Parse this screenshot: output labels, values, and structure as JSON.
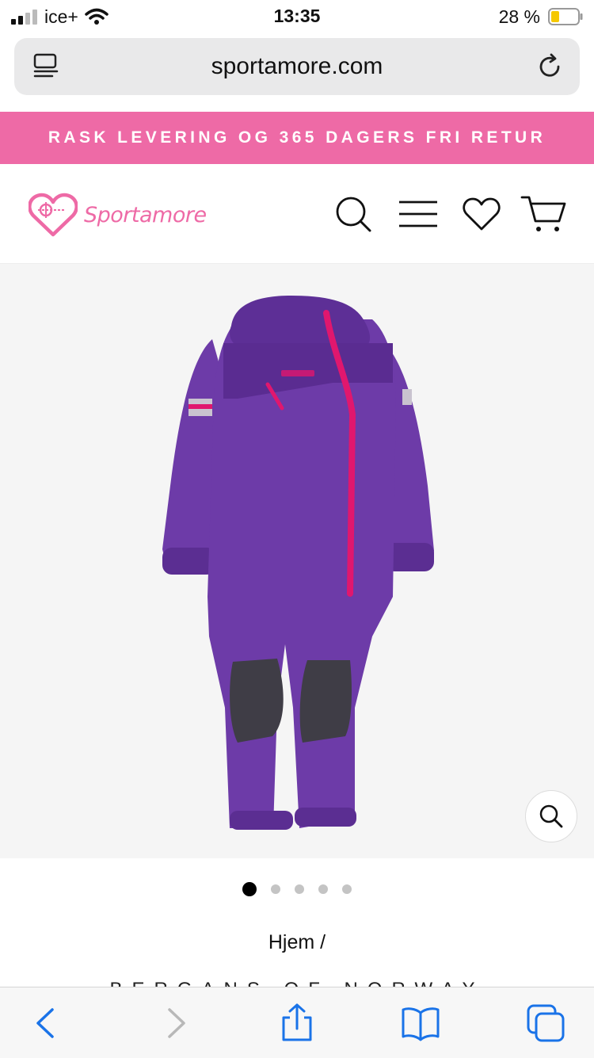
{
  "status_bar": {
    "carrier": "ice+",
    "time": "13:35",
    "battery": "28 %"
  },
  "browser": {
    "url": "sportamore.com"
  },
  "promo": {
    "text": "RASK LEVERING OG 365 DAGERS FRI RETUR"
  },
  "header": {
    "logo_text": "Sportamore"
  },
  "colors": {
    "brand_pink": "#ee6aa6",
    "product_purple": "#6a3aa3",
    "zipper_pink": "#e0176e"
  },
  "icons": [
    "reader-icon",
    "reload-icon",
    "search-icon",
    "menu-icon",
    "heart-icon",
    "cart-icon",
    "zoom-icon",
    "back-icon",
    "forward-icon",
    "share-icon",
    "bookmarks-icon",
    "tabs-icon"
  ],
  "carousel": {
    "count": 5,
    "active": 1
  },
  "breadcrumb": {
    "text": "Hjem /"
  },
  "brand": {
    "text": "BERGANS OF NORWAY"
  }
}
